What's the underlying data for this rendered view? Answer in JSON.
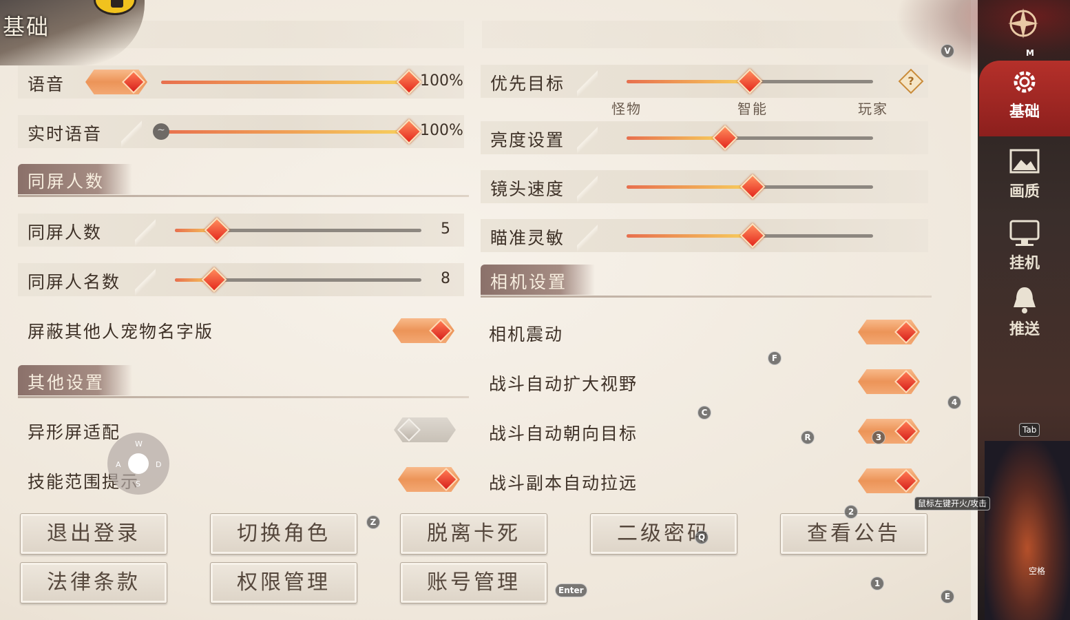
{
  "page": {
    "title": "基础"
  },
  "sidebar": {
    "items": [
      {
        "label": "基础",
        "active": true,
        "icon": "gear-icon"
      },
      {
        "label": "画质",
        "icon": "picture-icon"
      },
      {
        "label": "挂机",
        "icon": "monitor-icon"
      },
      {
        "label": "推送",
        "icon": "bell-icon"
      }
    ],
    "top_icon": "compass-emblem-icon"
  },
  "left": {
    "voice": {
      "label": "语音",
      "value": 100,
      "text": "100%"
    },
    "realtime_voice": {
      "label": "实时语音",
      "value": 100,
      "text": "100%"
    },
    "section_screen": "同屏人数",
    "screen_players": {
      "label": "同屏人数",
      "value": 5,
      "max": 20,
      "text": "5"
    },
    "screen_names": {
      "label": "同屏人名数",
      "value": 8,
      "max": 40,
      "text": "8"
    },
    "hide_pet_names": {
      "label": "屏蔽其他人宠物名字版",
      "on": true
    },
    "section_other": "其他设置",
    "notch_adapt": {
      "label": "异形屏适配",
      "on": false
    },
    "skill_range": {
      "label": "技能范围提示",
      "on": true
    }
  },
  "right": {
    "priority_target": {
      "label": "优先目标",
      "value": 0.5,
      "ticks": [
        "怪物",
        "智能",
        "玩家"
      ],
      "help": "?"
    },
    "brightness": {
      "label": "亮度设置",
      "value": 0.4
    },
    "camera_speed": {
      "label": "镜头速度",
      "value": 0.5
    },
    "aim_sensitivity": {
      "label": "瞄准灵敏",
      "value": 0.5
    },
    "section_camera": "相机设置",
    "camera_shake": {
      "label": "相机震动",
      "on": true
    },
    "auto_expand_view": {
      "label": "战斗自动扩大视野",
      "on": true
    },
    "auto_face_target": {
      "label": "战斗自动朝向目标",
      "on": true
    },
    "dungeon_auto_zoom": {
      "label": "战斗副本自动拉远",
      "on": true
    }
  },
  "buttons": {
    "logout": "退出登录",
    "switch_role": "切换角色",
    "unstuck": "脱离卡死",
    "second_password": "二级密码",
    "view_notice": "查看公告",
    "legal": "法律条款",
    "permissions": "权限管理",
    "account": "账号管理"
  },
  "key_hints": {
    "v": "V",
    "m": "M",
    "f": "F",
    "c": "C",
    "r": "R",
    "three": "3",
    "four": "4",
    "tab": "Tab",
    "z": "Z",
    "q": "Q",
    "two": "2",
    "one": "1",
    "enter": "Enter",
    "e": "E",
    "space": "空格",
    "mouse": "鼠标左键开火/攻击",
    "w": "W",
    "a": "A",
    "s": "S",
    "d": "D",
    "minus": "~"
  },
  "colors": {
    "accent": "#e4281d",
    "fill_start": "#e86f4e",
    "fill_end": "#f7d05d",
    "sidebar_active": "#b5302a"
  }
}
